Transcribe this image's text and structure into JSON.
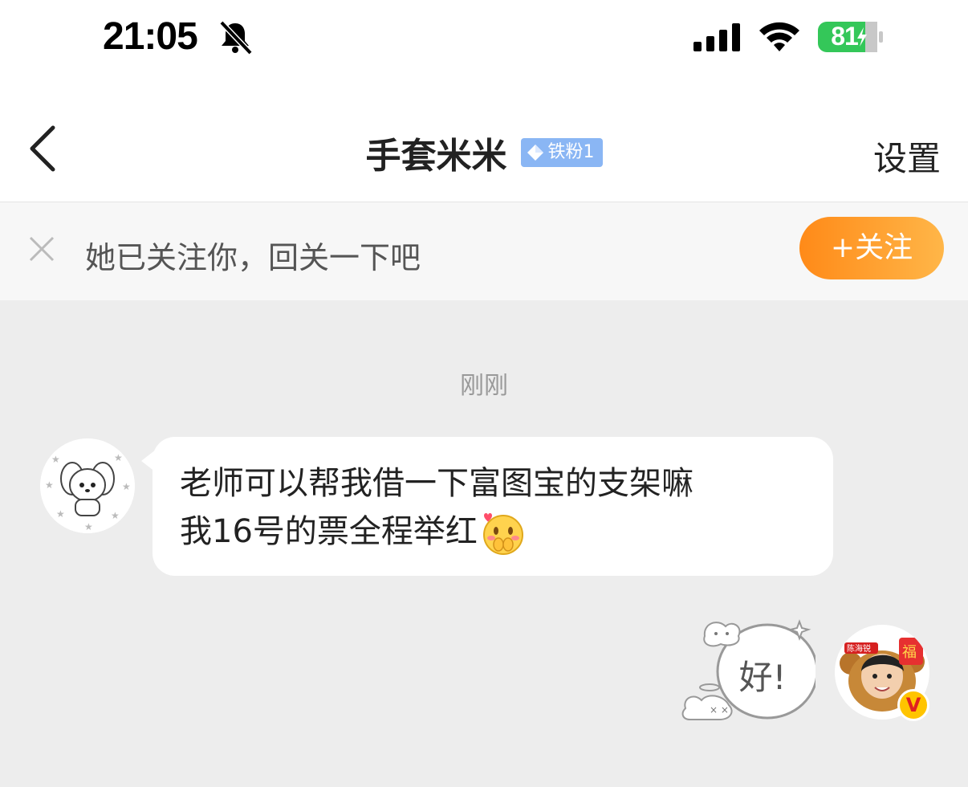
{
  "status_bar": {
    "time": "21:05",
    "battery": "81",
    "battery_color": "#34c759"
  },
  "navbar": {
    "title": "手套米米",
    "badge": "铁粉1",
    "badge_color": "#8ab6f4",
    "settings": "设置",
    "back_icon": "chevron-left-icon"
  },
  "follow_bar": {
    "text": "她已关注你，回关一下吧",
    "button": "+关注",
    "close_icon": "close-icon",
    "button_color": "#ff9a22"
  },
  "chat": {
    "timestamp": "刚刚",
    "messages": [
      {
        "side": "left",
        "text_line1": "老师可以帮我借一下富图宝的支架嘛",
        "text_line2": "我16号的票全程举红",
        "emoji": "shy-face-emoji"
      },
      {
        "side": "right",
        "sticker_text": "好!",
        "avatar_badge": "V",
        "avatar_label": "陈海锐"
      }
    ]
  }
}
